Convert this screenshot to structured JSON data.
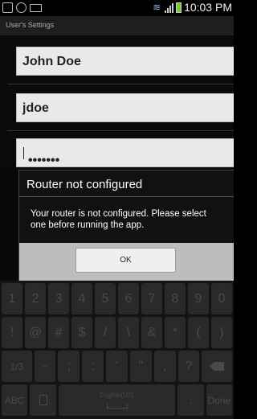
{
  "status_bar": {
    "time": "10:03 PM"
  },
  "title_bar": {
    "title": "User's Settings"
  },
  "form": {
    "name": "John Doe",
    "username": "jdoe",
    "password": "•••••••"
  },
  "dialog": {
    "title": "Router not configured",
    "message": "Your router is not configured. Please select one before running the app.",
    "ok_label": "OK"
  },
  "keyboard": {
    "row1": [
      "1",
      "2",
      "3",
      "4",
      "5",
      "6",
      "7",
      "8",
      "9",
      "0"
    ],
    "row2": [
      "!",
      "@",
      "#",
      "$",
      "/",
      "\\",
      "&",
      "*",
      "(",
      ")"
    ],
    "row3": {
      "page": "1/3",
      "keys": [
        "-",
        ";",
        ":",
        "'",
        "\"",
        ",",
        "?"
      ]
    },
    "row4": {
      "abc": "ABC",
      "space": "English(US)",
      "period": ".",
      "done": "Done"
    }
  }
}
